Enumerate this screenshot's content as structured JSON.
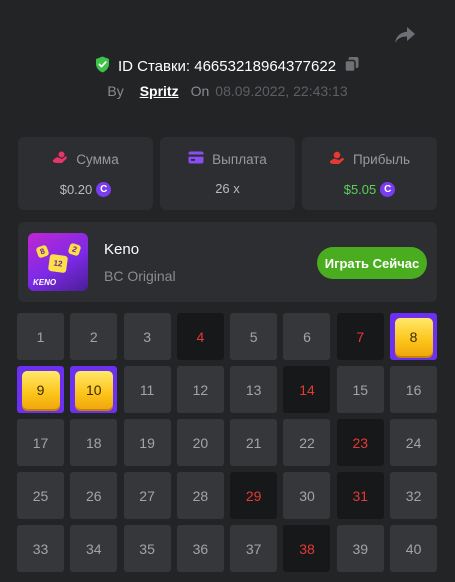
{
  "header": {
    "bet_label": "ID Ставки:",
    "bet_id": "46653218964377622",
    "by_label": "By",
    "user": "Spritz",
    "on_label": "On",
    "date": "08.09.2022, 22:43:13"
  },
  "stats": [
    {
      "label": "Сумма",
      "value": "$0.20",
      "icon": "hand-coin-icon"
    },
    {
      "label": "Выплата",
      "value": "26 x",
      "icon": "wallet-card-icon"
    },
    {
      "label": "Прибыль",
      "value": "$5.05",
      "icon": "profit-hand-icon"
    }
  ],
  "game": {
    "name": "Keno",
    "subtitle": "BC Original",
    "play_label": "Играть Сейчас",
    "thumb_numbers": [
      "8",
      "12",
      "2"
    ],
    "thumb_text": "KENO"
  },
  "coin_symbol": "C",
  "colors": {
    "accent_purple": "#6c31f0",
    "drawn_number": "#e53935",
    "play_button": "#4aad1f",
    "profit": "#5ad15a"
  },
  "board": {
    "cells": [
      {
        "n": "1",
        "state": "default"
      },
      {
        "n": "2",
        "state": "default"
      },
      {
        "n": "3",
        "state": "default"
      },
      {
        "n": "4",
        "state": "drawn"
      },
      {
        "n": "5",
        "state": "default"
      },
      {
        "n": "6",
        "state": "default"
      },
      {
        "n": "7",
        "state": "drawn"
      },
      {
        "n": "8",
        "state": "hit"
      },
      {
        "n": "9",
        "state": "hit"
      },
      {
        "n": "10",
        "state": "hit"
      },
      {
        "n": "11",
        "state": "default"
      },
      {
        "n": "12",
        "state": "default"
      },
      {
        "n": "13",
        "state": "default"
      },
      {
        "n": "14",
        "state": "drawn"
      },
      {
        "n": "15",
        "state": "default"
      },
      {
        "n": "16",
        "state": "default"
      },
      {
        "n": "17",
        "state": "default"
      },
      {
        "n": "18",
        "state": "default"
      },
      {
        "n": "19",
        "state": "default"
      },
      {
        "n": "20",
        "state": "default"
      },
      {
        "n": "21",
        "state": "default"
      },
      {
        "n": "22",
        "state": "default"
      },
      {
        "n": "23",
        "state": "drawn"
      },
      {
        "n": "24",
        "state": "default"
      },
      {
        "n": "25",
        "state": "default"
      },
      {
        "n": "26",
        "state": "default"
      },
      {
        "n": "27",
        "state": "default"
      },
      {
        "n": "28",
        "state": "default"
      },
      {
        "n": "29",
        "state": "drawn"
      },
      {
        "n": "30",
        "state": "default"
      },
      {
        "n": "31",
        "state": "drawn"
      },
      {
        "n": "32",
        "state": "default"
      },
      {
        "n": "33",
        "state": "default"
      },
      {
        "n": "34",
        "state": "default"
      },
      {
        "n": "35",
        "state": "default"
      },
      {
        "n": "36",
        "state": "default"
      },
      {
        "n": "37",
        "state": "default"
      },
      {
        "n": "38",
        "state": "drawn"
      },
      {
        "n": "39",
        "state": "default"
      },
      {
        "n": "40",
        "state": "default"
      }
    ]
  }
}
